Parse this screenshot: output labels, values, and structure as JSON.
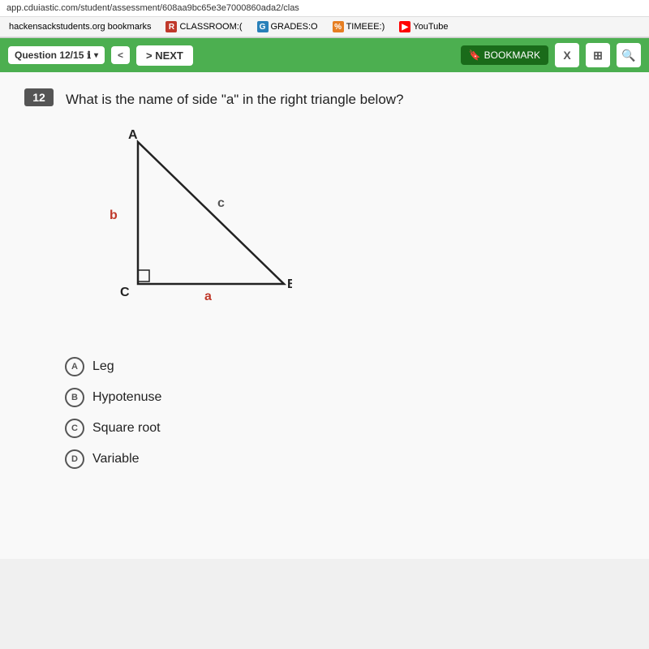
{
  "browser": {
    "url": "app.cduiastic.com/student/assessment/608aa9bc65e3e7000860ada2/clas",
    "bookmarks": [
      {
        "label": "hackensackstudents.org bookmarks",
        "icon": "",
        "iconClass": ""
      },
      {
        "label": "CLASSROOM:(",
        "icon": "R",
        "iconClass": "bm-red"
      },
      {
        "label": "GRADES:O",
        "icon": "G",
        "iconClass": "bm-blue"
      },
      {
        "label": "TIMEEE:)",
        "icon": "%",
        "iconClass": "bm-orange"
      },
      {
        "label": "YouTube",
        "icon": "▶",
        "iconClass": "bm-youtube"
      }
    ]
  },
  "toolbar": {
    "question_label": "Question 12/15",
    "prev_label": "<",
    "next_label": "> NEXT",
    "bookmark_label": "BOOKMARK",
    "close_label": "X"
  },
  "question": {
    "number": "12",
    "text": "What is the name of side \"a\" in the right triangle below?",
    "choices": [
      {
        "letter": "A",
        "text": "Leg"
      },
      {
        "letter": "B",
        "text": "Hypotenuse"
      },
      {
        "letter": "C",
        "text": "Square root"
      },
      {
        "letter": "D",
        "text": "Variable"
      }
    ]
  },
  "triangle": {
    "vertex_a": "A",
    "vertex_b": "B",
    "vertex_c": "C",
    "side_a": "a",
    "side_b": "b",
    "side_c": "c"
  }
}
